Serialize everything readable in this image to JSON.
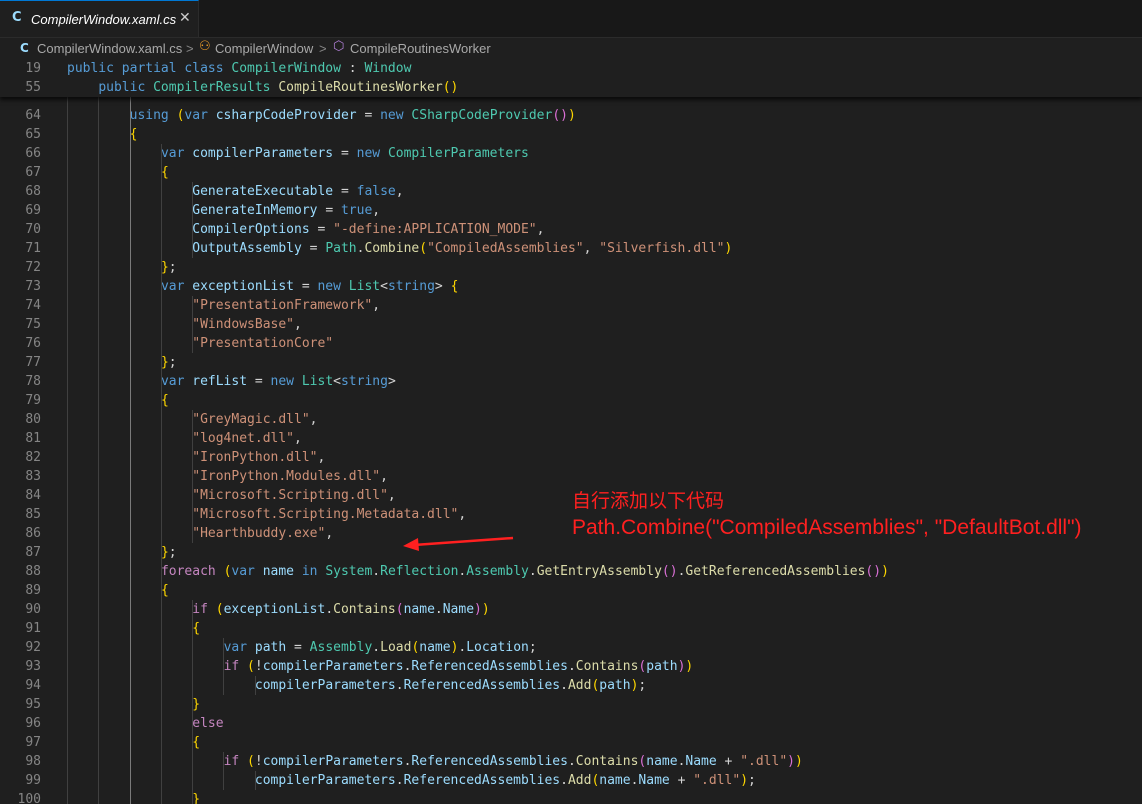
{
  "tab": {
    "icon": "csharp-file-icon",
    "glyph": "C",
    "title": "CompilerWindow.xaml.cs",
    "close_glyph": "✕"
  },
  "breadcrumb": {
    "file": "CompilerWindow.xaml.cs",
    "class": "CompilerWindow",
    "method": "CompileRoutinesWorker",
    "separator": ">"
  },
  "sticky_lines": [
    {
      "num": "19",
      "text": "        public partial class CompilerWindow : Window"
    },
    {
      "num": "55",
      "text": "            public CompilerResults CompileRoutinesWorker()"
    }
  ],
  "lines": [
    {
      "num": "64",
      "text": "                using (var csharpCodeProvider = new CSharpCodeProvider())"
    },
    {
      "num": "65",
      "text": "                {"
    },
    {
      "num": "66",
      "text": "                    var compilerParameters = new CompilerParameters"
    },
    {
      "num": "67",
      "text": "                    {"
    },
    {
      "num": "68",
      "text": "                        GenerateExecutable = false,"
    },
    {
      "num": "69",
      "text": "                        GenerateInMemory = true,"
    },
    {
      "num": "70",
      "text": "                        CompilerOptions = \"-define:APPLICATION_MODE\","
    },
    {
      "num": "71",
      "text": "                        OutputAssembly = Path.Combine(\"CompiledAssemblies\", \"Silverfish.dll\")"
    },
    {
      "num": "72",
      "text": "                    };"
    },
    {
      "num": "73",
      "text": "                    var exceptionList = new List<string> {"
    },
    {
      "num": "74",
      "text": "                        \"PresentationFramework\","
    },
    {
      "num": "75",
      "text": "                        \"WindowsBase\","
    },
    {
      "num": "76",
      "text": "                        \"PresentationCore\""
    },
    {
      "num": "77",
      "text": "                    };"
    },
    {
      "num": "78",
      "text": "                    var refList = new List<string>"
    },
    {
      "num": "79",
      "text": "                    {"
    },
    {
      "num": "80",
      "text": "                        \"GreyMagic.dll\","
    },
    {
      "num": "81",
      "text": "                        \"log4net.dll\","
    },
    {
      "num": "82",
      "text": "                        \"IronPython.dll\","
    },
    {
      "num": "83",
      "text": "                        \"IronPython.Modules.dll\","
    },
    {
      "num": "84",
      "text": "                        \"Microsoft.Scripting.dll\","
    },
    {
      "num": "85",
      "text": "                        \"Microsoft.Scripting.Metadata.dll\","
    },
    {
      "num": "86",
      "text": "                        \"Hearthbuddy.exe\","
    },
    {
      "num": "87",
      "text": "                    };"
    },
    {
      "num": "88",
      "text": "                    foreach (var name in System.Reflection.Assembly.GetEntryAssembly().GetReferencedAssemblies())"
    },
    {
      "num": "89",
      "text": "                    {"
    },
    {
      "num": "90",
      "text": "                        if (exceptionList.Contains(name.Name))"
    },
    {
      "num": "91",
      "text": "                        {"
    },
    {
      "num": "92",
      "text": "                            var path = Assembly.Load(name).Location;"
    },
    {
      "num": "93",
      "text": "                            if (!compilerParameters.ReferencedAssemblies.Contains(path))"
    },
    {
      "num": "94",
      "text": "                                compilerParameters.ReferencedAssemblies.Add(path);"
    },
    {
      "num": "95",
      "text": "                        }"
    },
    {
      "num": "96",
      "text": "                        else"
    },
    {
      "num": "97",
      "text": "                        {"
    },
    {
      "num": "98",
      "text": "                            if (!compilerParameters.ReferencedAssemblies.Contains(name.Name + \".dll\"))"
    },
    {
      "num": "99",
      "text": "                                compilerParameters.ReferencedAssemblies.Add(name.Name + \".dll\");"
    },
    {
      "num": "100",
      "text": "                        }"
    }
  ],
  "annotation": {
    "line1": "自行添加以下代码",
    "line2": "Path.Combine(\"CompiledAssemblies\", \"DefaultBot.dll\")",
    "color": "#ff2020"
  },
  "colors": {
    "keyword": "#569cd6",
    "control": "#c586c0",
    "type": "#4ec9b0",
    "method": "#dcdcaa",
    "variable": "#9cdcfe",
    "string": "#ce9178",
    "editor_bg": "#1f1f1f"
  }
}
